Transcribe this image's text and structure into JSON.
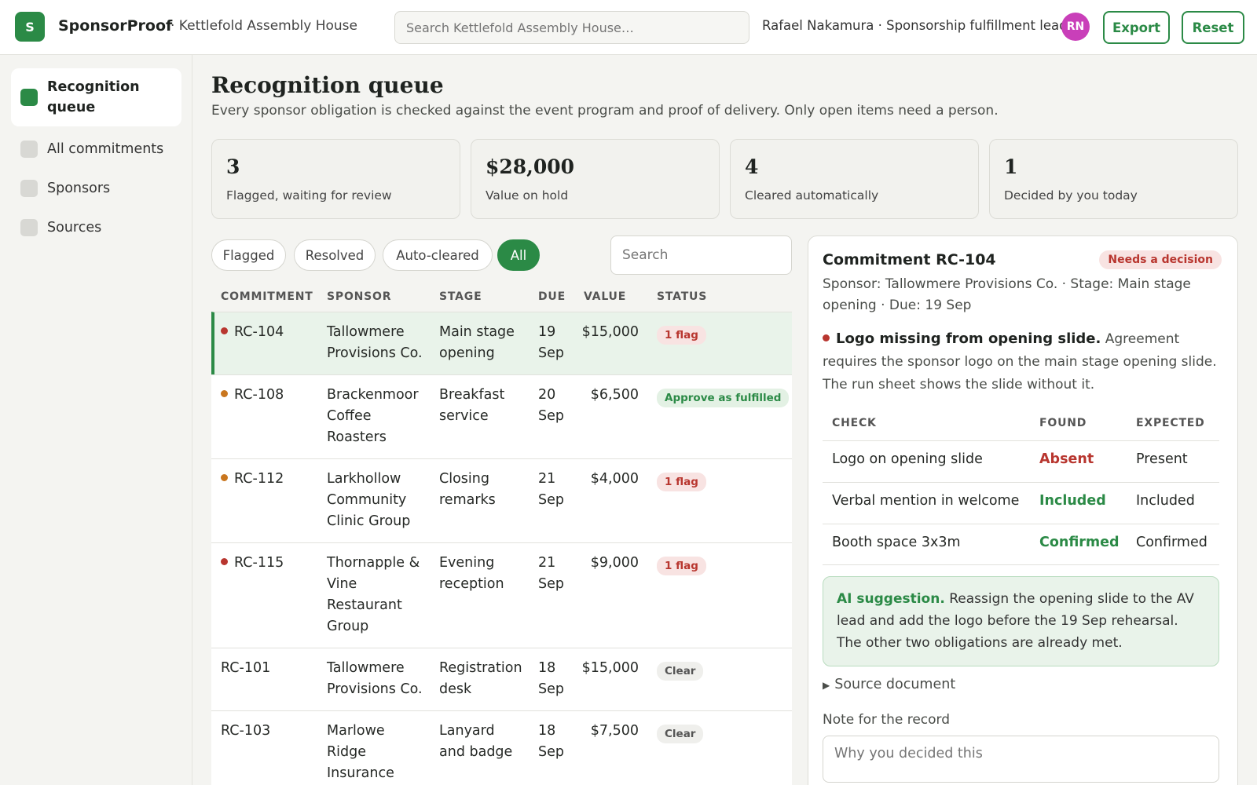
{
  "app": {
    "logo_letter": "S",
    "name": "SponsorProof",
    "org": "· Kettlefold Assembly House",
    "search_placeholder": "Search Kettlefold Assembly House…",
    "user": "Rafael Nakamura · Sponsorship fulfillment lead",
    "avatar_initials": "RN",
    "export_label": "Export",
    "reset_label": "Reset",
    "accent": "#2b8a46"
  },
  "sidebar": {
    "items": [
      {
        "label": "Recognition queue",
        "active": true
      },
      {
        "label": "All commitments",
        "active": false
      },
      {
        "label": "Sponsors",
        "active": false
      },
      {
        "label": "Sources",
        "active": false
      }
    ]
  },
  "page": {
    "title": "Recognition queue",
    "subtitle": "Every sponsor obligation is checked against the event program and proof of delivery. Only open items need a person."
  },
  "stats": [
    {
      "value": "3",
      "label": "Flagged, waiting for review"
    },
    {
      "value": "$28,000",
      "label": "Value on hold"
    },
    {
      "value": "4",
      "label": "Cleared automatically"
    },
    {
      "value": "1",
      "label": "Decided by you today"
    }
  ],
  "filters": {
    "chips": [
      "Flagged",
      "Resolved",
      "Auto-cleared",
      "All"
    ],
    "active": "All",
    "search_placeholder": "Search"
  },
  "table": {
    "headers": [
      "COMMITMENT",
      "SPONSOR",
      "STAGE",
      "DUE",
      "VALUE",
      "STATUS"
    ],
    "rows": [
      {
        "id": "RC-104",
        "dot": "#b8362f",
        "sponsor": "Tallowmere Provisions Co.",
        "stage": "Main stage opening",
        "due": "19 Sep",
        "value": "$15,000",
        "status": "1 flag",
        "status_type": "flag",
        "selected": true
      },
      {
        "id": "RC-108",
        "dot": "#c9761e",
        "sponsor": "Brackenmoor Coffee Roasters",
        "stage": "Breakfast service",
        "due": "20 Sep",
        "value": "$6,500",
        "status": "Approve as fulfilled",
        "status_type": "approve",
        "selected": false
      },
      {
        "id": "RC-112",
        "dot": "#c9761e",
        "sponsor": "Larkhollow Community Clinic Group",
        "stage": "Closing remarks",
        "due": "21 Sep",
        "value": "$4,000",
        "status": "1 flag",
        "status_type": "flag",
        "selected": false
      },
      {
        "id": "RC-115",
        "dot": "#b8362f",
        "sponsor": "Thornapple & Vine Restaurant Group",
        "stage": "Evening reception",
        "due": "21 Sep",
        "value": "$9,000",
        "status": "1 flag",
        "status_type": "flag",
        "selected": false
      },
      {
        "id": "RC-101",
        "dot": "",
        "sponsor": "Tallowmere Provisions Co.",
        "stage": "Registration desk",
        "due": "18 Sep",
        "value": "$15,000",
        "status": "Clear",
        "status_type": "clear",
        "selected": false
      },
      {
        "id": "RC-103",
        "dot": "",
        "sponsor": "Marlowe Ridge Insurance",
        "stage": "Lanyard and badge",
        "due": "18 Sep",
        "value": "$7,500",
        "status": "Clear",
        "status_type": "clear",
        "selected": false
      }
    ]
  },
  "detail": {
    "title": "Commitment RC-104",
    "badge": "Needs a decision",
    "meta": "Sponsor: Tallowmere Provisions Co. · Stage: Main stage opening · Due: 19 Sep",
    "issue_title": "Logo missing from opening slide.",
    "issue_text": "Agreement requires the sponsor logo on the main stage opening slide. The run sheet shows the slide without it.",
    "checks_headers": [
      "CHECK",
      "FOUND",
      "EXPECTED"
    ],
    "checks": [
      {
        "check": "Logo on opening slide",
        "found": "Absent",
        "ok": false,
        "expected": "Present"
      },
      {
        "check": "Verbal mention in welcome",
        "found": "Included",
        "ok": true,
        "expected": "Included"
      },
      {
        "check": "Booth space 3x3m",
        "found": "Confirmed",
        "ok": true,
        "expected": "Confirmed"
      }
    ],
    "ai_label": "AI suggestion.",
    "ai_text": "Reassign the opening slide to the AV lead and add the logo before the 19 Sep rehearsal. The other two obligations are already met.",
    "source_label": "Source document",
    "note_label": "Note for the record",
    "note_placeholder": "Why you decided this"
  }
}
